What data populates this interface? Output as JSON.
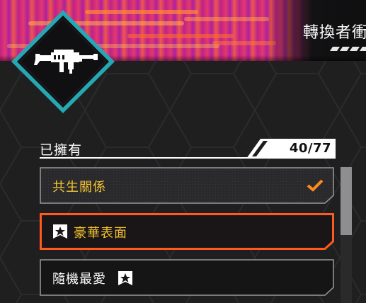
{
  "header": {
    "title": "轉換者衝",
    "weapon_icon": "assault-rifle-icon"
  },
  "owned": {
    "label": "已擁有",
    "count": "40/77"
  },
  "list": {
    "items": [
      {
        "label": "共生關係",
        "state": "equipped",
        "icon": "check-icon"
      },
      {
        "label": "豪華表面",
        "state": "selected",
        "icon": "star-badge-icon"
      },
      {
        "label": "隨機最愛",
        "state": "normal",
        "icon": "star-badge-icon"
      }
    ]
  },
  "colors": {
    "accent_orange": "#ff5a1f",
    "label_yellow": "#f2c230",
    "emblem_teal": "#27a6b3"
  }
}
